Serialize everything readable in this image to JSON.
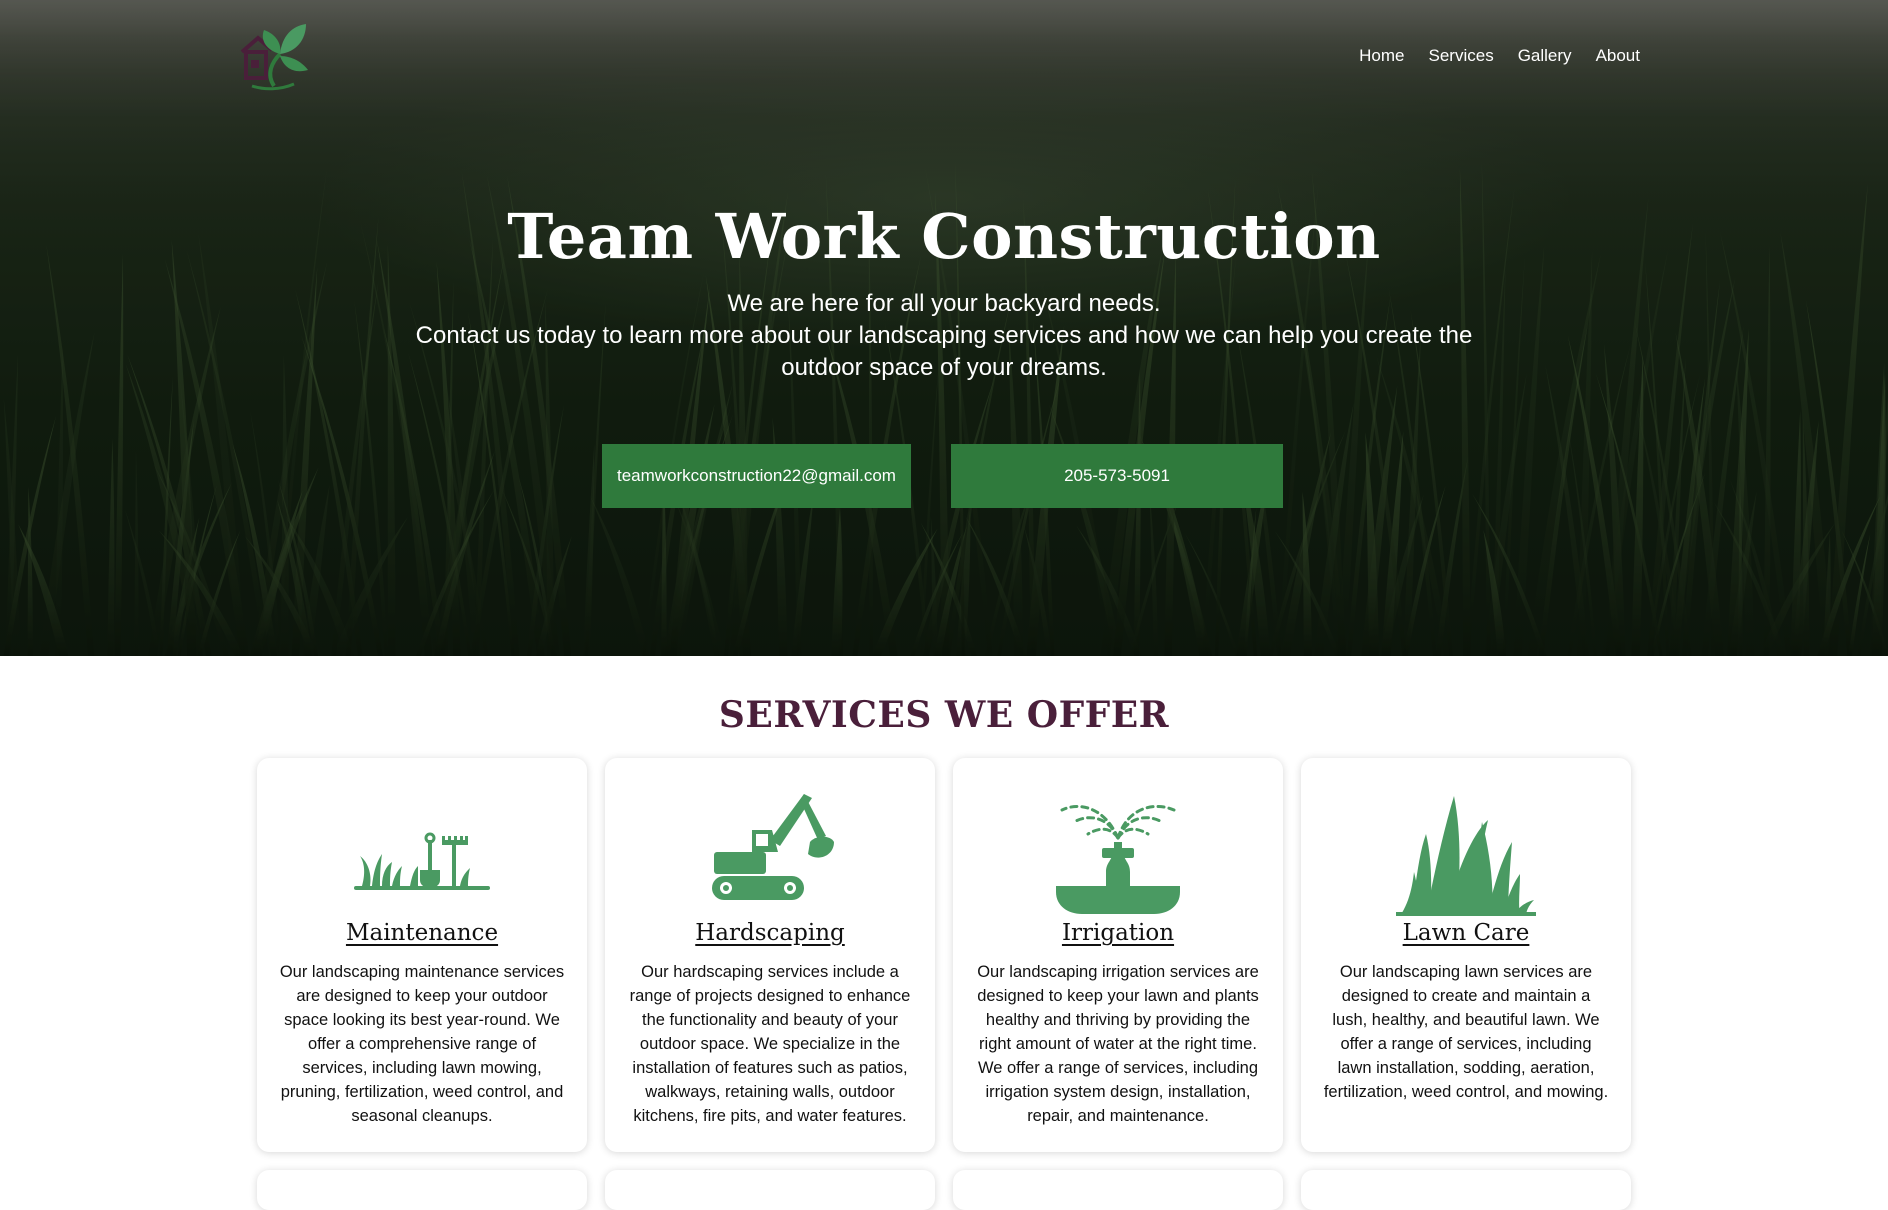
{
  "nav": {
    "home": "Home",
    "services": "Services",
    "gallery": "Gallery",
    "about": "About"
  },
  "hero": {
    "title": "Team Work Construction",
    "subtitle_line1": "We are here for all your backyard needs.",
    "subtitle_line2": "Contact us today to learn more about our landscaping services and how we can help you create the outdoor space of your dreams.",
    "email_button": "teamworkconstruction22@gmail.com",
    "phone_button": "205-573-5091"
  },
  "services": {
    "heading": "SERVICES WE OFFER",
    "items": [
      {
        "icon": "garden-tools-icon",
        "title": "Maintenance",
        "text": "Our landscaping maintenance services are designed to keep your outdoor space looking its best year-round. We offer a comprehensive range of services, including lawn mowing, pruning, fertilization, weed control, and seasonal cleanups."
      },
      {
        "icon": "excavator-icon",
        "title": "Hardscaping",
        "text": "Our hardscaping services include a range of projects designed to enhance the functionality and beauty of your outdoor space. We specialize in the installation of features such as patios, walkways, retaining walls, outdoor kitchens, fire pits, and water features."
      },
      {
        "icon": "sprinkler-icon",
        "title": "Irrigation",
        "text": "Our landscaping irrigation services are designed to keep your lawn and plants healthy and thriving by providing the right amount of water at the right time. We offer a range of services, including irrigation system design, installation, repair, and maintenance."
      },
      {
        "icon": "grass-icon",
        "title": "Lawn Care",
        "text": "Our landscaping lawn services are designed to create and maintain a lush, healthy, and beautiful lawn. We offer a range of services, including lawn installation, sodding, aeration, fertilization, weed control, and mowing."
      }
    ]
  },
  "colors": {
    "brand_green": "#2f7a3c",
    "icon_green": "#4a9a62",
    "heading_plum": "#4a1f3a"
  }
}
